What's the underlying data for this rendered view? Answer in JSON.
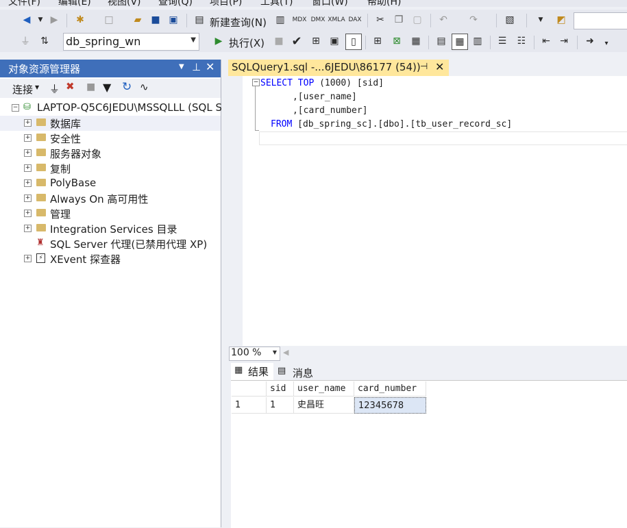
{
  "menu": {
    "items": [
      "文件(F)",
      "编辑(E)",
      "视图(V)",
      "查询(Q)",
      "项目(P)",
      "工具(T)",
      "窗口(W)",
      "帮助(H)"
    ]
  },
  "toolbar": {
    "new_query_label": "新建查询(N)",
    "database_combo": "db_spring_wn",
    "execute_label": "执行(X)"
  },
  "object_explorer": {
    "title": "对象资源管理器",
    "connect_label": "连接",
    "server": "LAPTOP-Q5C6JEDU\\MSSQLLL (SQL S",
    "nodes": [
      "数据库",
      "安全性",
      "服务器对象",
      "复制",
      "PolyBase",
      "Always On 高可用性",
      "管理",
      "Integration Services 目录",
      "SQL Server 代理(已禁用代理 XP)",
      "XEvent 探查器"
    ]
  },
  "editor": {
    "tab_title": "SQLQuery1.sql -...6JEDU\\86177 (54))",
    "zoom": "100 %",
    "code": {
      "l1_kw1": "SELECT",
      "l1_kw2": "TOP",
      "l1_rest": " (1000) [sid]",
      "l2": "      ,[user_name]",
      "l3": "      ,[card_number]",
      "l4_kw": "FROM",
      "l4_rest": " [db_spring_sc].[dbo].[tb_user_record_sc]"
    }
  },
  "results": {
    "tabs": {
      "results": "结果",
      "messages": "消息"
    },
    "columns": [
      "sid",
      "user_name",
      "card_number"
    ],
    "rows": [
      {
        "rownum": "1",
        "sid": "1",
        "user_name": "史昌旺",
        "card_number": "12345678"
      }
    ]
  }
}
